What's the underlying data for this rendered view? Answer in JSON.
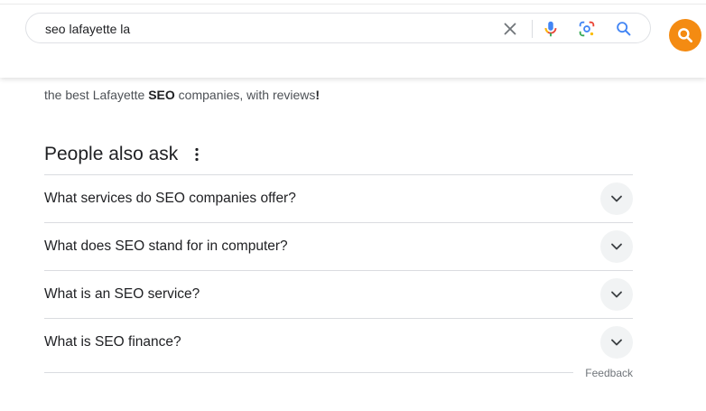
{
  "search": {
    "query": "seo lafayette la",
    "icons": {
      "clear": "close-icon",
      "voice": "microphone-icon",
      "lens": "google-lens-icon",
      "search": "search-icon"
    }
  },
  "extension_button": {
    "icon": "search-icon",
    "color": "#f48b12"
  },
  "snippet": {
    "line1_prefix": "the best Lafayette ",
    "line1_bold": "SEO",
    "line1_suffix": " companies, with reviews",
    "line1_end": "!"
  },
  "people_also_ask": {
    "title": "People also ask",
    "questions": [
      "What services do SEO companies offer?",
      "What does SEO stand for in computer?",
      "What is an SEO service?",
      "What is SEO finance?"
    ]
  },
  "feedback": {
    "label": "Feedback"
  },
  "colors": {
    "text_primary": "#202124",
    "text_secondary": "#4d5156",
    "divider": "#dadce0",
    "chevron_bg": "#f1f3f4",
    "search_blue": "#4285f4"
  }
}
